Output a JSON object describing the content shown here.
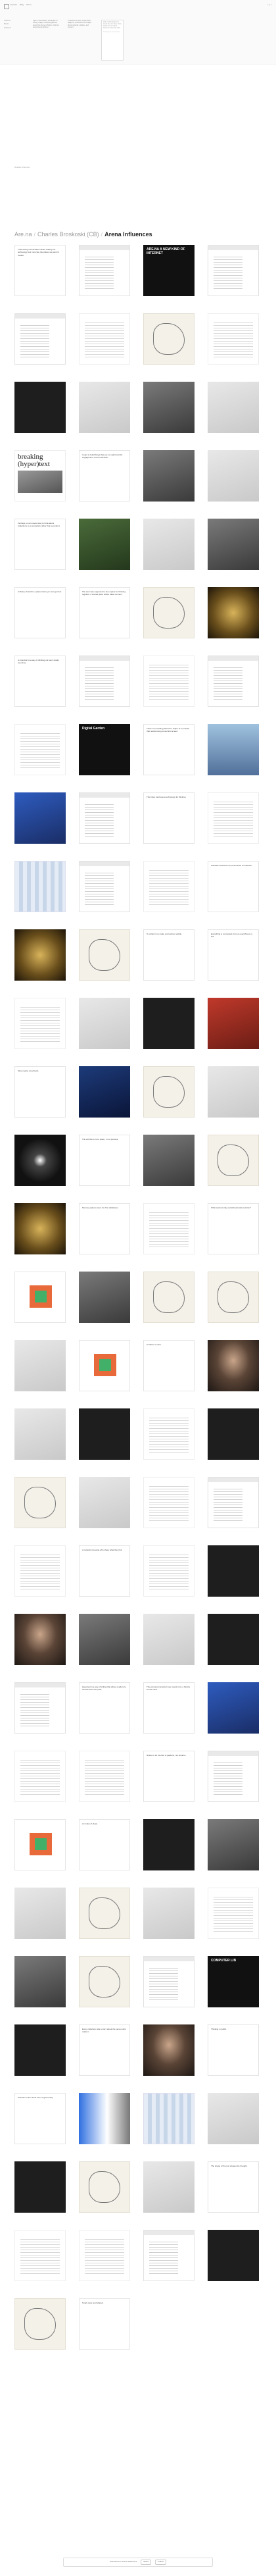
{
  "header": {
    "links": [
      "Explore",
      "Blog",
      "About"
    ],
    "right_label": "Log in",
    "meta": [
      "Channel",
      "Blocks",
      "Followers"
    ],
    "intro_col1": "Open in the browser: a collection of writing, images, and links gathered around the theme of broken, informal and personal archives.",
    "intro_col2": "A collection of texts, screenshots, diagrams, documents and images about networks, software, and memory.",
    "popup": {
      "text": "Chan visual things here. Cut at the end, these forms which were as sold a system on how their data...",
      "credit": "Posted by the channel owner"
    }
  },
  "section_label": "Related channels",
  "channel_title": {
    "owner": "Are.na",
    "author": "Charles Broskoski (CB)",
    "name": "Arena Influences"
  },
  "blocks": [
    {
      "type": "text",
      "caption": "",
      "text": "I had a long conversation about making our technology feel more like the places we want to inhabit."
    },
    {
      "type": "web",
      "caption": ""
    },
    {
      "type": "poster",
      "caption": "",
      "text": "ARE.NA A NEW KIND OF INTERNET"
    },
    {
      "type": "web",
      "caption": ""
    },
    {
      "type": "web",
      "caption": ""
    },
    {
      "type": "doc",
      "caption": ""
    },
    {
      "type": "sketch",
      "caption": ""
    },
    {
      "type": "doc",
      "caption": ""
    },
    {
      "type": "dark",
      "caption": ""
    },
    {
      "type": "light",
      "caption": ""
    },
    {
      "type": "photo",
      "caption": ""
    },
    {
      "type": "light",
      "caption": ""
    },
    {
      "type": "breaking",
      "caption": "",
      "text": "breaking (hyper)text"
    },
    {
      "type": "text",
      "caption": "",
      "text": "I want to build things that are not optimized for engagement, but for attention."
    },
    {
      "type": "photo",
      "caption": ""
    },
    {
      "type": "light",
      "caption": ""
    },
    {
      "type": "text",
      "caption": "",
      "text": "Perhaps a more useful way to think about collections is as a practice rather than a product."
    },
    {
      "type": "green",
      "caption": ""
    },
    {
      "type": "light",
      "caption": ""
    },
    {
      "type": "photo",
      "caption": ""
    },
    {
      "type": "text",
      "caption": "",
      "text": "A library should be a place where you can get lost."
    },
    {
      "type": "text",
      "caption": "",
      "text": "The web was supposed to be a space for thinking together, a shared place where ideas connect."
    },
    {
      "type": "sketch",
      "caption": ""
    },
    {
      "type": "gold",
      "caption": ""
    },
    {
      "type": "text",
      "caption": "",
      "text": "A collection is a way of thinking out loud, slowly, over time."
    },
    {
      "type": "web",
      "caption": ""
    },
    {
      "type": "doc",
      "caption": ""
    },
    {
      "type": "web",
      "caption": ""
    },
    {
      "type": "doc",
      "caption": ""
    },
    {
      "type": "poster",
      "caption": "",
      "text": "Digital Garden"
    },
    {
      "type": "text",
      "caption": "",
      "text": "There is something about the shape of a network that resists being turned into a feed."
    },
    {
      "type": "sky",
      "caption": ""
    },
    {
      "type": "blue",
      "caption": ""
    },
    {
      "type": "web",
      "caption": ""
    },
    {
      "type": "text",
      "caption": "",
      "text": "The index card was a technology for thinking."
    },
    {
      "type": "doc",
      "caption": ""
    },
    {
      "type": "stripes",
      "caption": ""
    },
    {
      "type": "web",
      "caption": ""
    },
    {
      "type": "doc",
      "caption": ""
    },
    {
      "type": "text",
      "caption": "",
      "text": "Software should be as personal as a notebook."
    },
    {
      "type": "gold",
      "caption": ""
    },
    {
      "type": "sketch",
      "caption": ""
    },
    {
      "type": "text",
      "caption": "",
      "text": "To collect is to make connections visible."
    },
    {
      "type": "text",
      "caption": "",
      "text": "Everything is connected, but not everything is a link."
    },
    {
      "type": "doc",
      "caption": ""
    },
    {
      "type": "light",
      "caption": ""
    },
    {
      "type": "dark",
      "caption": ""
    },
    {
      "type": "red",
      "caption": ""
    },
    {
      "type": "text",
      "caption": "",
      "text": "Slow media, small tools."
    },
    {
      "type": "hands",
      "caption": ""
    },
    {
      "type": "sketch",
      "caption": ""
    },
    {
      "type": "light",
      "caption": ""
    },
    {
      "type": "eye",
      "caption": ""
    },
    {
      "type": "text",
      "caption": "",
      "text": "The archive is not a place, it is a process."
    },
    {
      "type": "photo",
      "caption": ""
    },
    {
      "type": "sketch",
      "caption": ""
    },
    {
      "type": "gold",
      "caption": ""
    },
    {
      "type": "text",
      "caption": "",
      "text": "Memory palaces were the first databases."
    },
    {
      "type": "doc",
      "caption": ""
    },
    {
      "type": "text",
      "caption": "",
      "text": "What would a truly social bookmark look like?"
    },
    {
      "type": "orange",
      "caption": ""
    },
    {
      "type": "photo",
      "caption": ""
    },
    {
      "type": "sketch",
      "caption": ""
    },
    {
      "type": "sketch",
      "caption": ""
    },
    {
      "type": "light",
      "caption": ""
    },
    {
      "type": "orange",
      "caption": ""
    },
    {
      "type": "text",
      "caption": "",
      "text": "Curation as care."
    },
    {
      "type": "person",
      "caption": ""
    },
    {
      "type": "light",
      "caption": ""
    },
    {
      "type": "dark",
      "caption": ""
    },
    {
      "type": "doc",
      "caption": ""
    },
    {
      "type": "dark",
      "caption": ""
    },
    {
      "type": "sketch",
      "caption": ""
    },
    {
      "type": "light",
      "caption": ""
    },
    {
      "type": "doc",
      "caption": ""
    },
    {
      "type": "web",
      "caption": ""
    },
    {
      "type": "doc",
      "caption": ""
    },
    {
      "type": "text",
      "caption": "",
      "text": "A network of people who share what they find."
    },
    {
      "type": "doc",
      "caption": ""
    },
    {
      "type": "dark",
      "caption": ""
    },
    {
      "type": "person",
      "caption": ""
    },
    {
      "type": "photo",
      "caption": ""
    },
    {
      "type": "light",
      "caption": ""
    },
    {
      "type": "dark",
      "caption": ""
    },
    {
      "type": "web",
      "caption": ""
    },
    {
      "type": "text",
      "caption": "",
      "text": "Hypertext is a way of writing that allows readers to choose their own path."
    },
    {
      "type": "text",
      "caption": "",
      "text": "The personal computer was meant to be a bicycle for the mind."
    },
    {
      "type": "blue",
      "caption": ""
    },
    {
      "type": "doc",
      "caption": ""
    },
    {
      "type": "doc",
      "caption": ""
    },
    {
      "type": "text",
      "caption": "",
      "text": "Notes on an internet of gardens, not streams."
    },
    {
      "type": "web",
      "caption": ""
    },
    {
      "type": "orange",
      "caption": ""
    },
    {
      "type": "text",
      "caption": "",
      "text": "An index of ideas."
    },
    {
      "type": "dark",
      "caption": ""
    },
    {
      "type": "photo",
      "caption": ""
    },
    {
      "type": "light",
      "caption": ""
    },
    {
      "type": "sketch",
      "caption": ""
    },
    {
      "type": "light",
      "caption": ""
    },
    {
      "type": "doc",
      "caption": ""
    },
    {
      "type": "photo",
      "caption": ""
    },
    {
      "type": "sketch",
      "caption": ""
    },
    {
      "type": "web",
      "caption": ""
    },
    {
      "type": "poster",
      "caption": "",
      "text": "COMPUTER LIB"
    },
    {
      "type": "dark",
      "caption": ""
    },
    {
      "type": "text",
      "caption": "",
      "text": "Every collection tells a story about the person who made it."
    },
    {
      "type": "person",
      "caption": ""
    },
    {
      "type": "text",
      "caption": "",
      "text": "Thinking in public."
    },
    {
      "type": "text",
      "caption": "",
      "text": "Attention is the rarest form of generosity."
    },
    {
      "type": "gradient",
      "caption": ""
    },
    {
      "type": "stripes",
      "caption": ""
    },
    {
      "type": "light",
      "caption": ""
    },
    {
      "type": "dark",
      "caption": ""
    },
    {
      "type": "sketch",
      "caption": ""
    },
    {
      "type": "light",
      "caption": ""
    },
    {
      "type": "text",
      "caption": "",
      "text": "The shape of the tool shapes the thought."
    },
    {
      "type": "doc",
      "caption": ""
    },
    {
      "type": "doc",
      "caption": ""
    },
    {
      "type": "web",
      "caption": ""
    },
    {
      "type": "dark",
      "caption": ""
    },
    {
      "type": "sketch",
      "caption": ""
    },
    {
      "type": "text",
      "caption": "",
      "text": "Small, slow, and shared."
    }
  ],
  "footer": {
    "text": "Add blocks to Arena Influences",
    "pill1": "Share",
    "pill2": "Follow"
  }
}
